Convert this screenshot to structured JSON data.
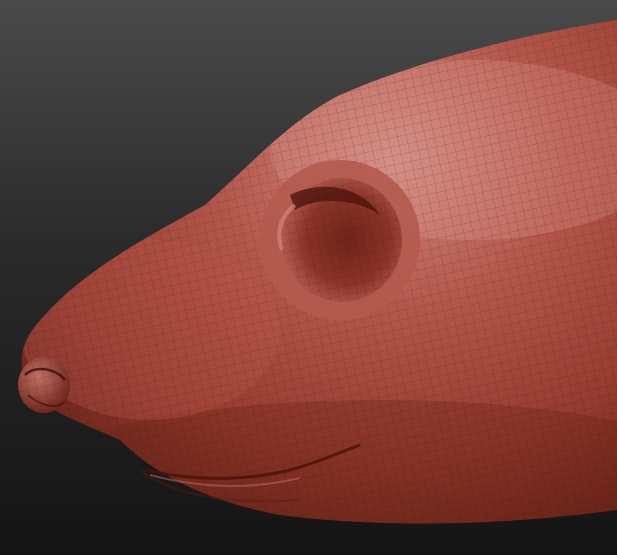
{
  "scene": {
    "subject": "sculpted-rodent-head-side-view",
    "material": "red-wax-clay",
    "wireframe": true,
    "colors": {
      "background_top": "#4a4a4a",
      "background_bottom": "#141414",
      "clay_light": "#c97a70",
      "clay_mid": "#a8473a",
      "clay_dark": "#5a1c14",
      "wire": "#2a0a06"
    }
  }
}
